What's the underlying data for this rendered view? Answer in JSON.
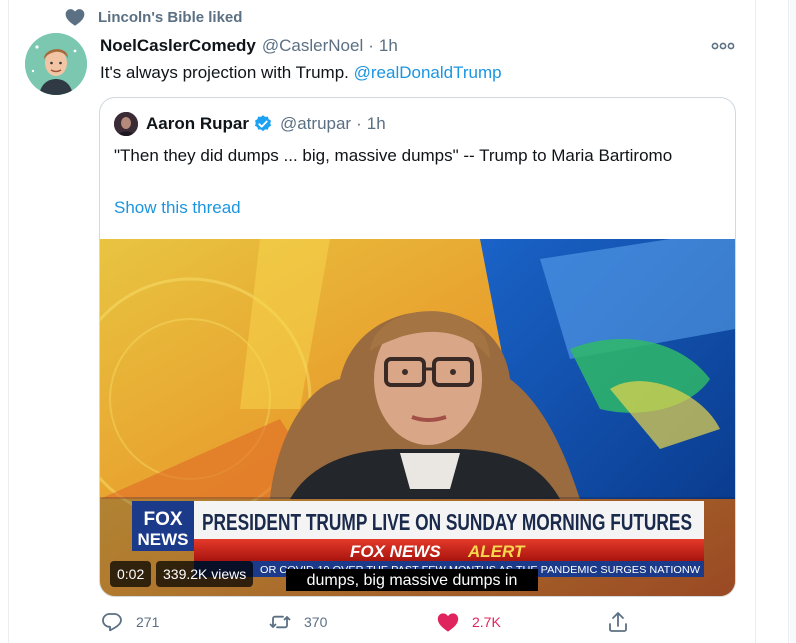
{
  "social_context": "Lincoln's Bible liked",
  "tweet": {
    "name": "NoelCaslerComedy",
    "handle": "@CaslerNoel",
    "separator": "·",
    "time": "1h",
    "text": "It's always projection with Trump.",
    "mention": "@realDonaldTrump"
  },
  "quote": {
    "name": "Aaron Rupar",
    "handle": "@atrupar",
    "separator": "·",
    "time": "1h",
    "text": "\"Then they did dumps ... big, massive dumps\" -- Trump to Maria Bartiromo",
    "show_thread": "Show this thread"
  },
  "video": {
    "chyron_headline": "PRESIDENT TRUMP LIVE ON SUNDAY MORNING FUTURES",
    "alert_prefix": "FOX NEWS",
    "alert_word": "ALERT",
    "logo_top": "FOX",
    "logo_bottom": "NEWS",
    "ticker_left": "OR COVID-19 OVER THE PAST FEW MONTHS AS THE PANDEMIC SURGES NATIONW",
    "caption": "dumps, big massive dumps in",
    "elapsed": "0:02",
    "views": "339.2K views"
  },
  "actions": {
    "replies": "271",
    "retweets": "370",
    "likes": "2.7K"
  },
  "colors": {
    "link": "#1b95e0",
    "muted": "#5b7083",
    "like": "#e0245e",
    "border": "#cfd9de"
  }
}
